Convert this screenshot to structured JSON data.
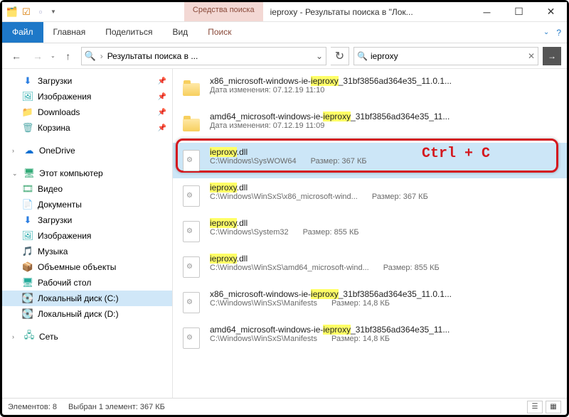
{
  "window": {
    "search_tools_label": "Средства поиска",
    "title": "ieproxy - Результаты поиска в \"Лок..."
  },
  "ribbon": {
    "file": "Файл",
    "home": "Главная",
    "share": "Поделиться",
    "view": "Вид",
    "search": "Поиск"
  },
  "nav": {
    "breadcrumb": "Результаты поиска в ...",
    "search_placeholder": "ieproxy",
    "search_value": "ieproxy"
  },
  "sidebar": {
    "quick": {
      "downloads": "Загрузки",
      "pictures": "Изображения",
      "downloads_en": "Downloads",
      "recycle": "Корзина"
    },
    "onedrive": "OneDrive",
    "thispc": {
      "label": "Этот компьютер",
      "video": "Видео",
      "documents": "Документы",
      "downloads": "Загрузки",
      "pictures": "Изображения",
      "music": "Музыка",
      "objects3d": "Объемные объекты",
      "desktop": "Рабочий стол",
      "disk_c": "Локальный диск (C:)",
      "disk_d": "Локальный диск (D:)"
    },
    "network": "Сеть"
  },
  "results": [
    {
      "name_pre": "x86_microsoft-windows-ie-",
      "name_hl": "ieproxy",
      "name_post": "_31bf3856ad364e35_11.0.1...",
      "detail1_label": "Дата изменения:",
      "detail1_val": "07.12.19 11:10",
      "type": "folder"
    },
    {
      "name_pre": "amd64_microsoft-windows-ie-",
      "name_hl": "ieproxy",
      "name_post": "_31bf3856ad364e35_11...",
      "detail1_label": "Дата изменения:",
      "detail1_val": "07.12.19 11:09",
      "type": "folder"
    },
    {
      "name_pre": "",
      "name_hl": "ieproxy",
      "name_post": ".dll",
      "detail1_label": "",
      "detail1_val": "C:\\Windows\\SysWOW64",
      "size_label": "Размер:",
      "size_val": "367 КБ",
      "type": "file",
      "selected": true
    },
    {
      "name_pre": "",
      "name_hl": "ieproxy",
      "name_post": ".dll",
      "detail1_label": "",
      "detail1_val": "C:\\Windows\\WinSxS\\x86_microsoft-wind...",
      "size_label": "Размер:",
      "size_val": "367 КБ",
      "type": "file"
    },
    {
      "name_pre": "",
      "name_hl": "ieproxy",
      "name_post": ".dll",
      "detail1_label": "",
      "detail1_val": "C:\\Windows\\System32",
      "size_label": "Размер:",
      "size_val": "855 КБ",
      "type": "file"
    },
    {
      "name_pre": "",
      "name_hl": "ieproxy",
      "name_post": ".dll",
      "detail1_label": "",
      "detail1_val": "C:\\Windows\\WinSxS\\amd64_microsoft-wind...",
      "size_label": "Размер:",
      "size_val": "855 КБ",
      "type": "file"
    },
    {
      "name_pre": "x86_microsoft-windows-ie-",
      "name_hl": "ieproxy",
      "name_post": "_31bf3856ad364e35_11.0.1...",
      "detail1_label": "",
      "detail1_val": "C:\\Windows\\WinSxS\\Manifests",
      "size_label": "Размер:",
      "size_val": "14,8 КБ",
      "type": "file-plain"
    },
    {
      "name_pre": "amd64_microsoft-windows-ie-",
      "name_hl": "ieproxy",
      "name_post": "_31bf3856ad364e35_11...",
      "detail1_label": "",
      "detail1_val": "C:\\Windows\\WinSxS\\Manifests",
      "size_label": "Размер:",
      "size_val": "14,8 КБ",
      "type": "file-plain"
    }
  ],
  "status": {
    "count_label": "Элементов: 8",
    "selection_label": "Выбран 1 элемент: 367 КБ"
  },
  "overlay": "Ctrl + C"
}
